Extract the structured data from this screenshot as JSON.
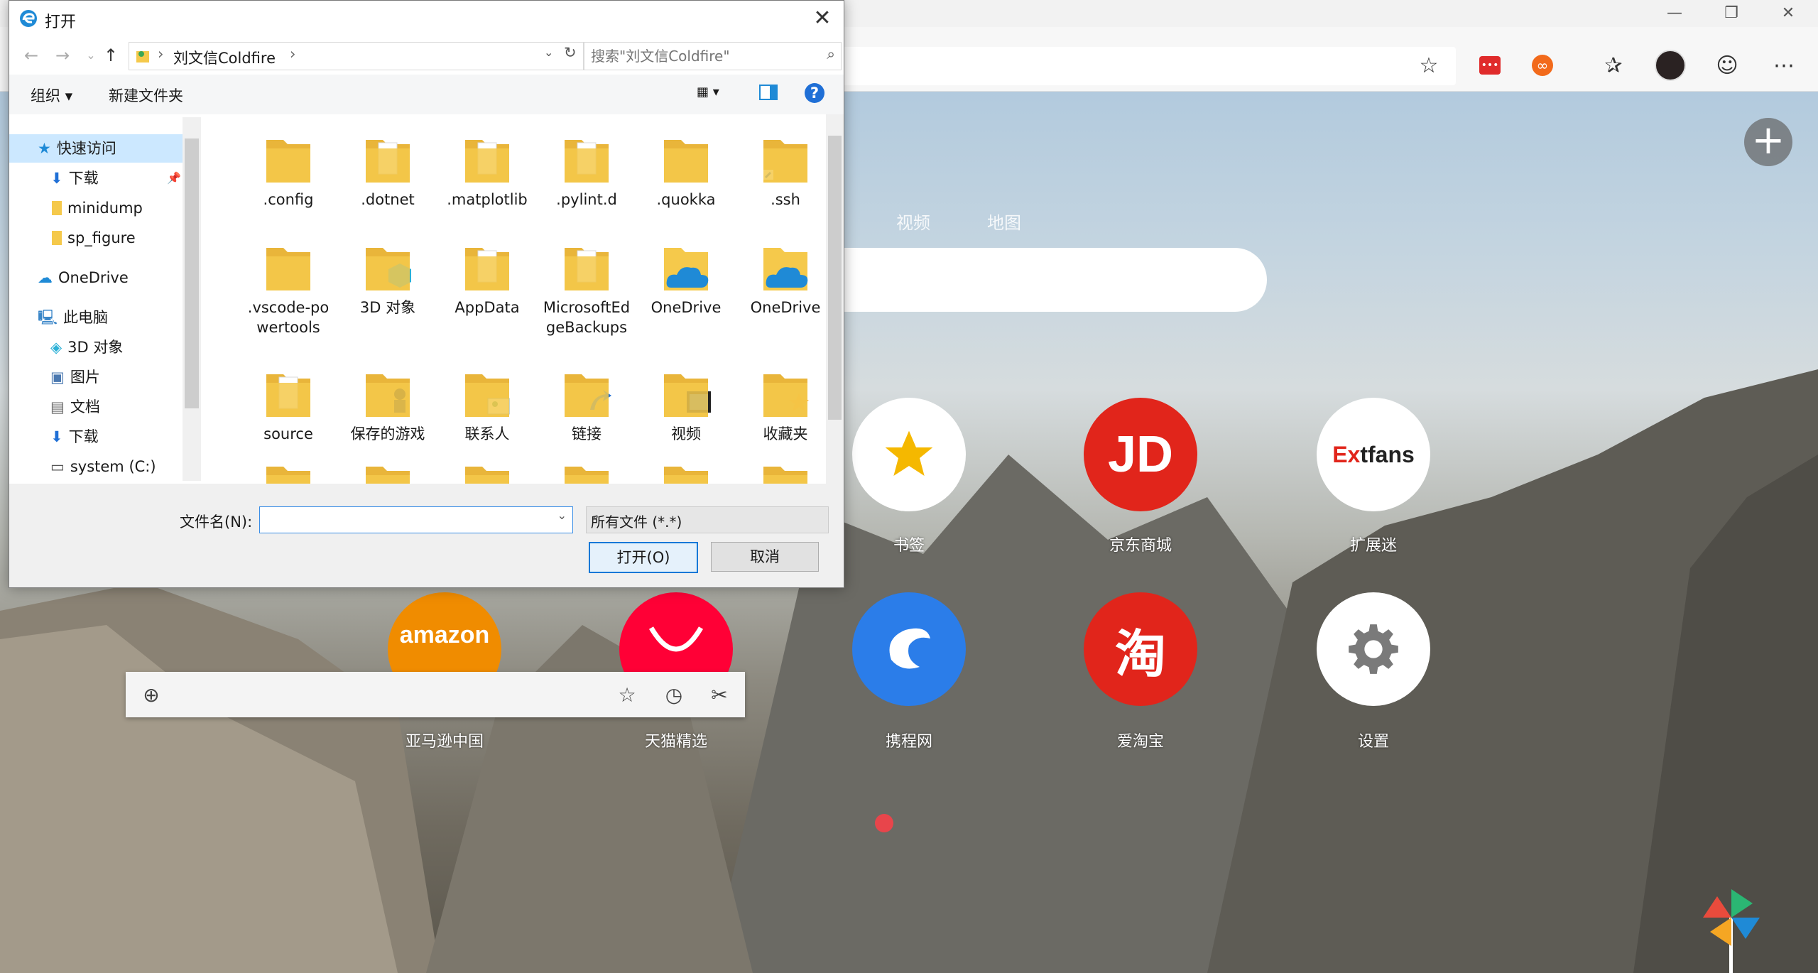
{
  "dialog": {
    "title": "打开",
    "breadcrumb": "刘文信Coldfire",
    "search_placeholder": "搜索\"刘文信Coldfire\"",
    "cmd_organize": "组织 ▾",
    "cmd_new_folder": "新建文件夹",
    "help": "?",
    "nav": {
      "quick_access": "快速访问",
      "downloads": "下载",
      "minidump": "minidump",
      "sp_figure": "sp_figure",
      "onedrive": "OneDrive",
      "this_pc": "此电脑",
      "objects3d": "3D 对象",
      "pictures": "图片",
      "documents": "文档",
      "downloads2": "下载",
      "system": "system (C:)"
    },
    "files": [
      ".config",
      ".dotnet",
      ".matplotlib",
      ".pylint.d",
      ".quokka",
      ".ssh",
      ".vscode-powertools",
      "3D 对象",
      "AppData",
      "MicrosoftEdgeBackups",
      "OneDrive",
      "OneDrive",
      "source",
      "保存的游戏",
      "联系人",
      "链接",
      "视频",
      "收藏夹"
    ],
    "filename_label": "文件名(N):",
    "filename_value": "",
    "filetype": "所有文件 (*.*)",
    "open_label": "打开(O)",
    "cancel_label": "取消"
  },
  "browser": {
    "search_tabs": [
      "视频",
      "地图"
    ],
    "tiles": [
      "书签",
      "京东商城",
      "扩展迷",
      "亚马逊中国",
      "天猫精选",
      "携程网",
      "爱淘宝",
      "设置"
    ],
    "tile_texts": {
      "jd": "JD",
      "extfans_ex": "Ex",
      "extfans_rest": "tfans",
      "amazon": "amazon",
      "taobao": "淘"
    },
    "add_label": "+"
  },
  "colors": {
    "accent": "#0078d7",
    "folder": "#f5c94b",
    "jd_red": "#e1251b",
    "amazon_orange": "#f08c00",
    "ctrip_blue": "#2b7de9"
  }
}
